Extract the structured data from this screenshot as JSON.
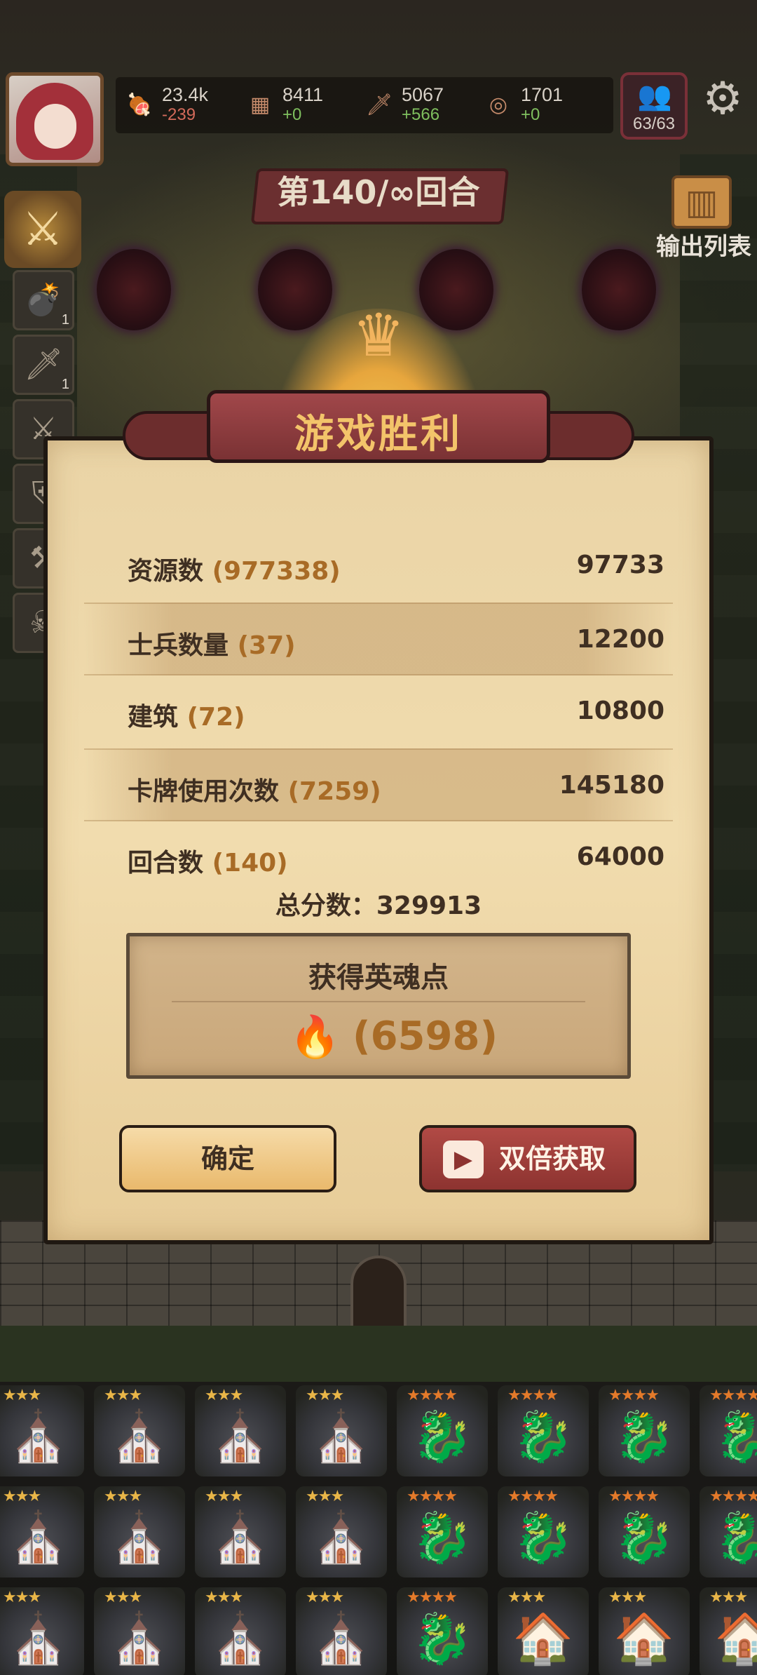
{
  "resources": [
    {
      "icon": "meat-icon",
      "value": "23.4k",
      "delta": "-239",
      "negative": true
    },
    {
      "icon": "wood-icon",
      "value": "8411",
      "delta": "+0",
      "negative": false
    },
    {
      "icon": "sword-resource-icon",
      "value": "5067",
      "delta": "+566",
      "negative": false
    },
    {
      "icon": "coin-icon",
      "value": "1701",
      "delta": "+0",
      "negative": false
    }
  ],
  "units": {
    "count": "63/63"
  },
  "round": {
    "label": "第140/∞回合"
  },
  "output_list": {
    "label": "输出列表"
  },
  "side_items": [
    {
      "icon": "cannon-icon",
      "count": "1"
    },
    {
      "icon": "dagger-icon",
      "count": "1"
    },
    {
      "icon": "sword-icon",
      "count": ""
    },
    {
      "icon": "shield-icon",
      "count": ""
    },
    {
      "icon": "hammer-icon",
      "count": ""
    },
    {
      "icon": "skull-icon",
      "count": ""
    }
  ],
  "panel": {
    "title": "游戏胜利",
    "rows": [
      {
        "label": "资源数",
        "qty": "(977338)",
        "value": "97733"
      },
      {
        "label": "士兵数量",
        "qty": "(37)",
        "value": "12200"
      },
      {
        "label": "建筑",
        "qty": "(72)",
        "value": "10800"
      },
      {
        "label": "卡牌使用次数",
        "qty": "(7259)",
        "value": "145180"
      },
      {
        "label": "回合数",
        "qty": "(140)",
        "value": "64000"
      }
    ],
    "total": "总分数：329913",
    "soul": {
      "heading": "获得英魂点",
      "amount": "(6598)"
    },
    "buttons": {
      "confirm": "确定",
      "double": "双倍获取"
    }
  },
  "grid": {
    "rows": [
      [
        "castle-3",
        "castle-3",
        "castle-3",
        "castle-3",
        "dragon-4",
        "dragon-4",
        "dragon-4",
        "dragon-4"
      ],
      [
        "castle-3",
        "castle-3",
        "castle-3",
        "castle-3",
        "dragon-4",
        "dragon-4",
        "dragon-4",
        "dragon-4"
      ],
      [
        "castle-3",
        "castle-3",
        "castle-3",
        "castle-3",
        "dragon-4",
        "house-3",
        "house-3",
        "house-3"
      ]
    ]
  },
  "colors": {
    "accent_gold": "#f3c46a",
    "panel_bg": "#f1dcae",
    "ribbon_red": "#8d3330",
    "qty_orange": "#a86b26"
  }
}
